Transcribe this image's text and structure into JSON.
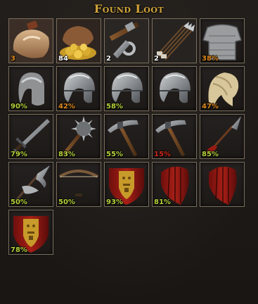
{
  "window": {
    "title": "Found Loot"
  },
  "colors": {
    "title": "#d3a53b",
    "good": "#b6d23b",
    "worn": "#e08a1e",
    "broken": "#d12a1e"
  },
  "items": [
    {
      "name": "loot-sack-goods-icon",
      "label": "3",
      "color": "#e08a1e"
    },
    {
      "name": "loot-sack-coins-icon",
      "label": "84",
      "color": "#ffffff"
    },
    {
      "name": "tools-bundle-icon",
      "label": "2",
      "color": "#ffffff"
    },
    {
      "name": "arrow-bundle-icon",
      "label": "2",
      "color": "#ffffff"
    },
    {
      "name": "chainmail-icon",
      "label": "38%",
      "color": "#e08a1e"
    },
    {
      "name": "mail-coif-icon",
      "label": "90%",
      "color": "#b6d23b"
    },
    {
      "name": "helmet-icon",
      "label": "42%",
      "color": "#e08a1e"
    },
    {
      "name": "helmet-icon",
      "label": "58%",
      "color": "#b6d23b"
    },
    {
      "name": "helmet-icon",
      "label": "",
      "color": "#b6d23b"
    },
    {
      "name": "cloth-hood-icon",
      "label": "47%",
      "color": "#e08a1e"
    },
    {
      "name": "sword-icon",
      "label": "79%",
      "color": "#b6d23b"
    },
    {
      "name": "morning-star-icon",
      "label": "83%",
      "color": "#b6d23b"
    },
    {
      "name": "pickaxe-icon",
      "label": "55%",
      "color": "#b6d23b"
    },
    {
      "name": "pickaxe-icon",
      "label": "15%",
      "color": "#d12a1e"
    },
    {
      "name": "spear-icon",
      "label": "85%",
      "color": "#b6d23b"
    },
    {
      "name": "billhook-icon",
      "label": "50%",
      "color": "#b6d23b"
    },
    {
      "name": "crossbow-icon",
      "label": "50%",
      "color": "#b6d23b"
    },
    {
      "name": "heater-shield-icon",
      "label": "93%",
      "color": "#b6d23b"
    },
    {
      "name": "kite-shield-icon",
      "label": "81%",
      "color": "#b6d23b"
    },
    {
      "name": "kite-shield-icon",
      "label": "",
      "color": "#b6d23b"
    },
    {
      "name": "heater-shield-icon",
      "label": "78%",
      "color": "#b6d23b"
    }
  ]
}
